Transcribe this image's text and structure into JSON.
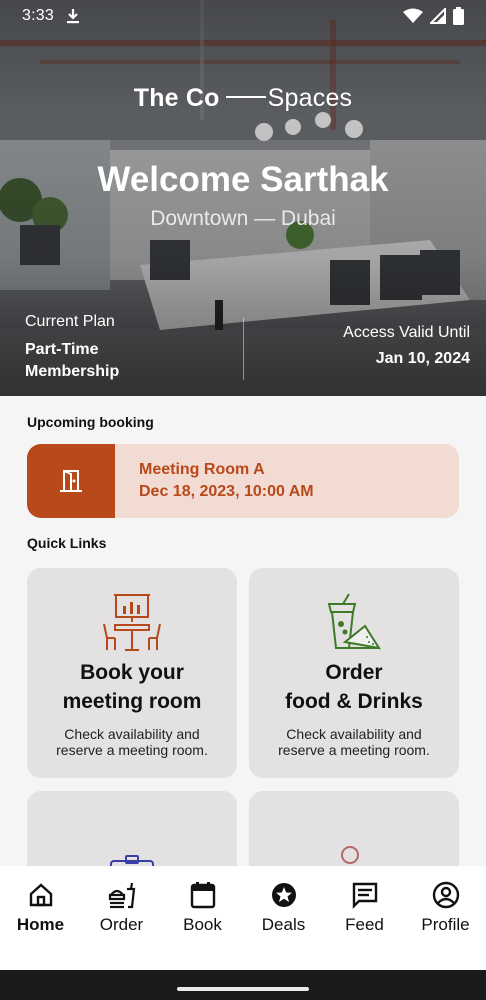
{
  "status_bar": {
    "time": "3:33"
  },
  "brand": {
    "part1": "The Co",
    "part2": "Spaces"
  },
  "hero": {
    "welcome": "Welcome Sarthak",
    "location": "Downtown — Dubai",
    "plan_label": "Current Plan",
    "plan_line1": "Part-Time",
    "plan_line2": "Membership",
    "access_label": "Access Valid Until",
    "access_value": "Jan 10, 2024"
  },
  "upcoming": {
    "title": "Upcoming booking",
    "room": "Meeting Room A",
    "datetime": "Dec 18, 2023, 10:00 AM"
  },
  "quick_links": {
    "title": "Quick Links",
    "cards": [
      {
        "title_line1": "Book your",
        "title_line2": "meeting room",
        "desc": "Check availability and reserve a meeting room.",
        "icon": "meeting-room-icon"
      },
      {
        "title_line1": "Order",
        "title_line2": "food & Drinks",
        "desc": "Check availability and reserve a meeting room.",
        "icon": "food-drink-icon"
      },
      {
        "icon": "id-card-icon"
      },
      {
        "icon": "user-check-icon"
      }
    ]
  },
  "nav": {
    "items": [
      {
        "label": "Home"
      },
      {
        "label": "Order"
      },
      {
        "label": "Book"
      },
      {
        "label": "Deals"
      },
      {
        "label": "Feed"
      },
      {
        "label": "Profile"
      }
    ]
  },
  "colors": {
    "accent": "#b8491a",
    "accent_light": "#f1dbd3",
    "food_green": "#3e7a28",
    "id_blue": "#3a3fa8",
    "user_rose": "#b46a6a"
  }
}
